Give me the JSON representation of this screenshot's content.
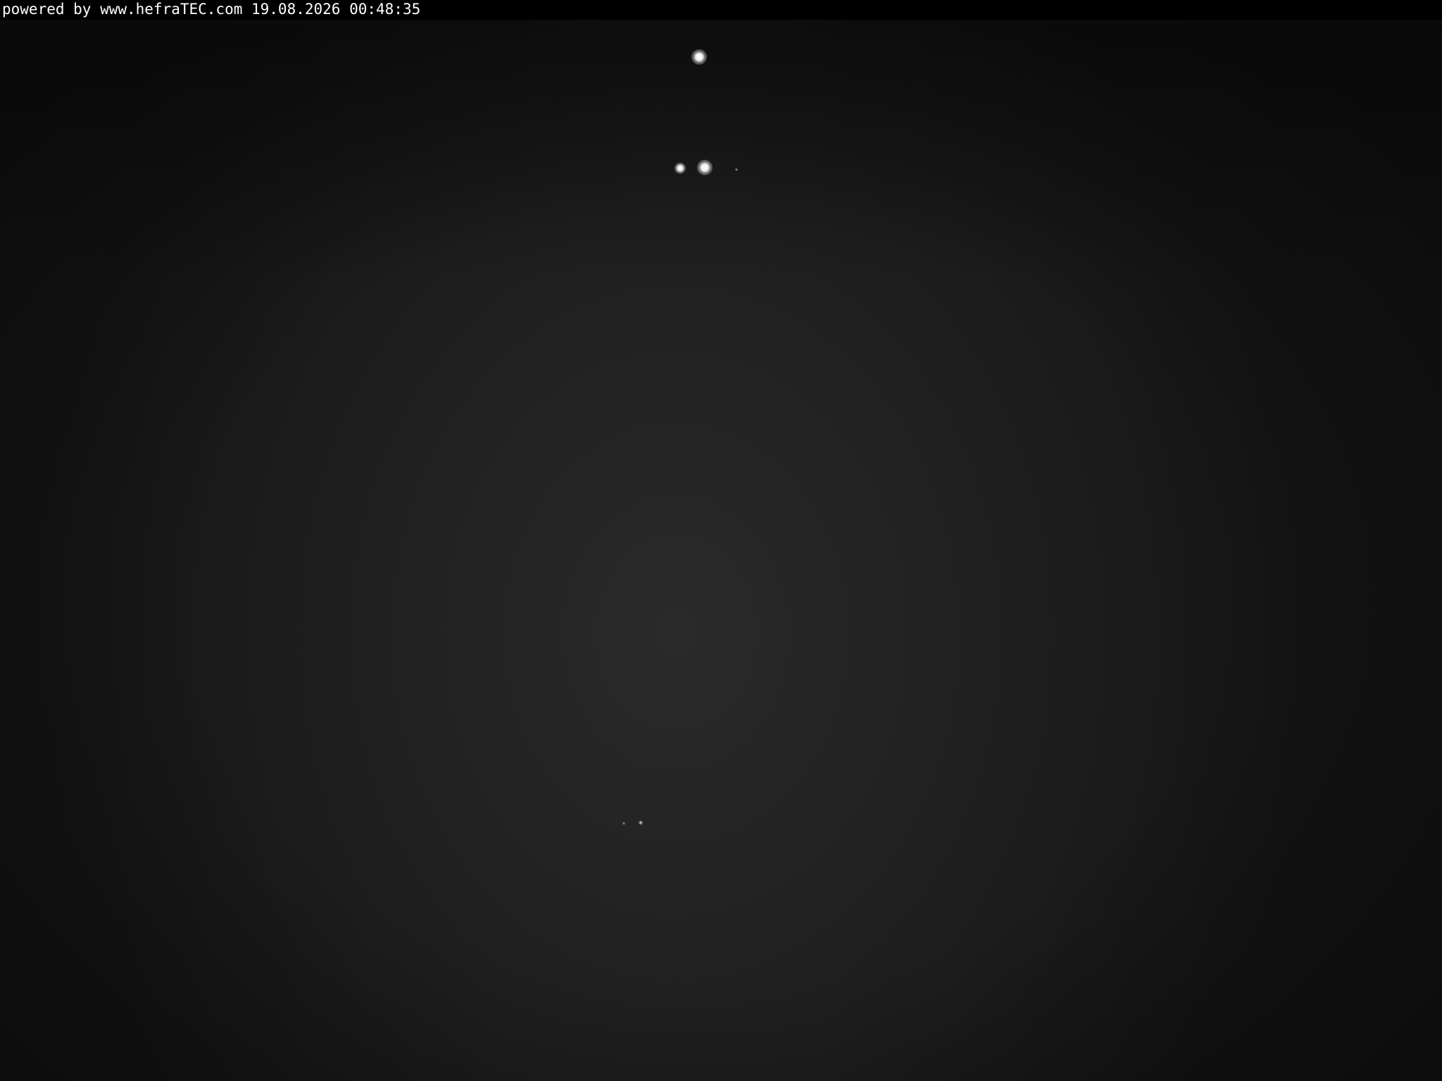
{
  "overlay": {
    "text": "powered by www.hefraTEC.com 19.08.2026 00:48:35"
  },
  "colors": {
    "overlay_background": "#000000",
    "overlay_text": "#ffffff",
    "scene_center": "#2a2a2a",
    "scene_edge": "#141414"
  }
}
